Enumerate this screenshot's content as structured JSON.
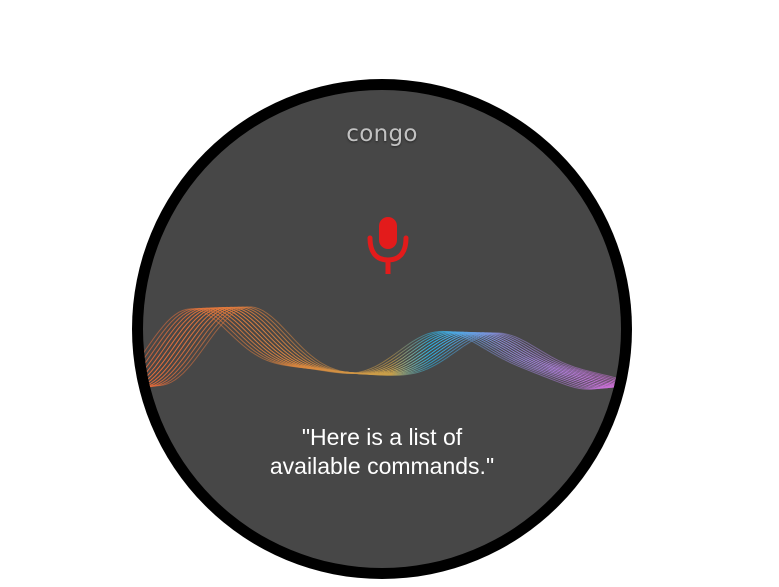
{
  "app": {
    "title": "congo"
  },
  "voice": {
    "state_icon": "microphone-icon",
    "response_lines": [
      "\"Here is a list of",
      "available commands.\""
    ]
  },
  "colors": {
    "screen": "#474747",
    "bezel": "#000000",
    "mic": "#e31b1b",
    "wave_start": "#e96a3a",
    "wave_mid": "#c9a14a",
    "wave_cyan": "#2bb7e8",
    "wave_end": "#d06cd5"
  }
}
